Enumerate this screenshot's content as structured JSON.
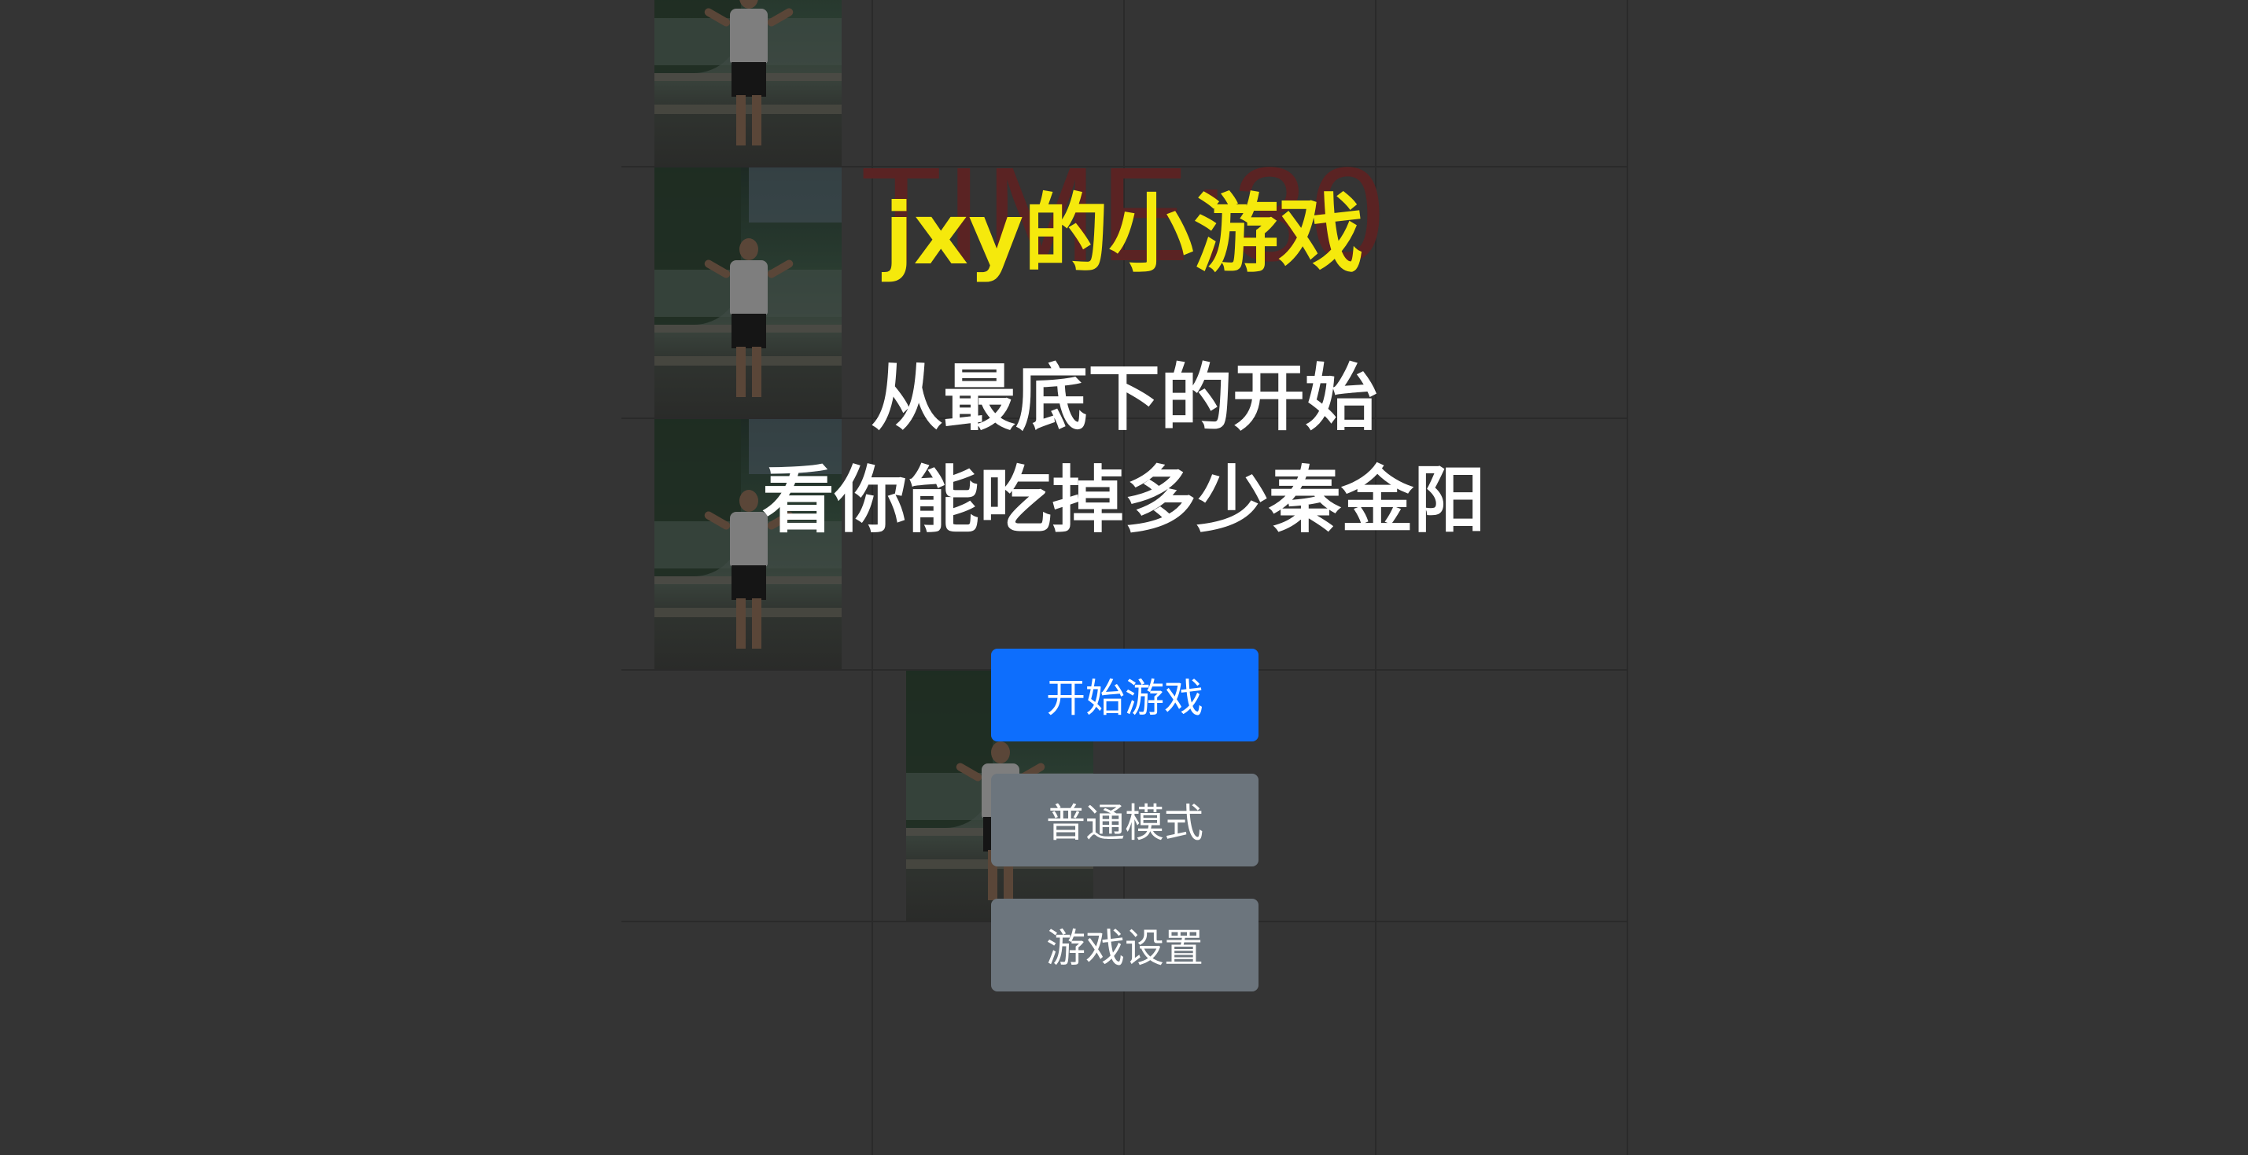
{
  "game": {
    "timer_text": "TIME:30",
    "title": "jxy的小游戏",
    "subtitle_line1": "从最底下的开始",
    "subtitle_line2": "看你能吃掉多少秦金阳"
  },
  "menu": {
    "start_label": "开始游戏",
    "mode_label": "普通模式",
    "settings_label": "游戏设置"
  },
  "colors": {
    "background": "#343434",
    "title": "#f5e90c",
    "primary_button": "#0d6efd",
    "secondary_button": "#6c757d",
    "timer": "#5a2323"
  },
  "board": {
    "columns": 4,
    "tile_image": "photo-of-person",
    "black_tile_positions": [
      {
        "row": 0,
        "col": 0
      },
      {
        "row": 1,
        "col": 0
      },
      {
        "row": 2,
        "col": 0
      },
      {
        "row": 3,
        "col": 1
      }
    ]
  }
}
